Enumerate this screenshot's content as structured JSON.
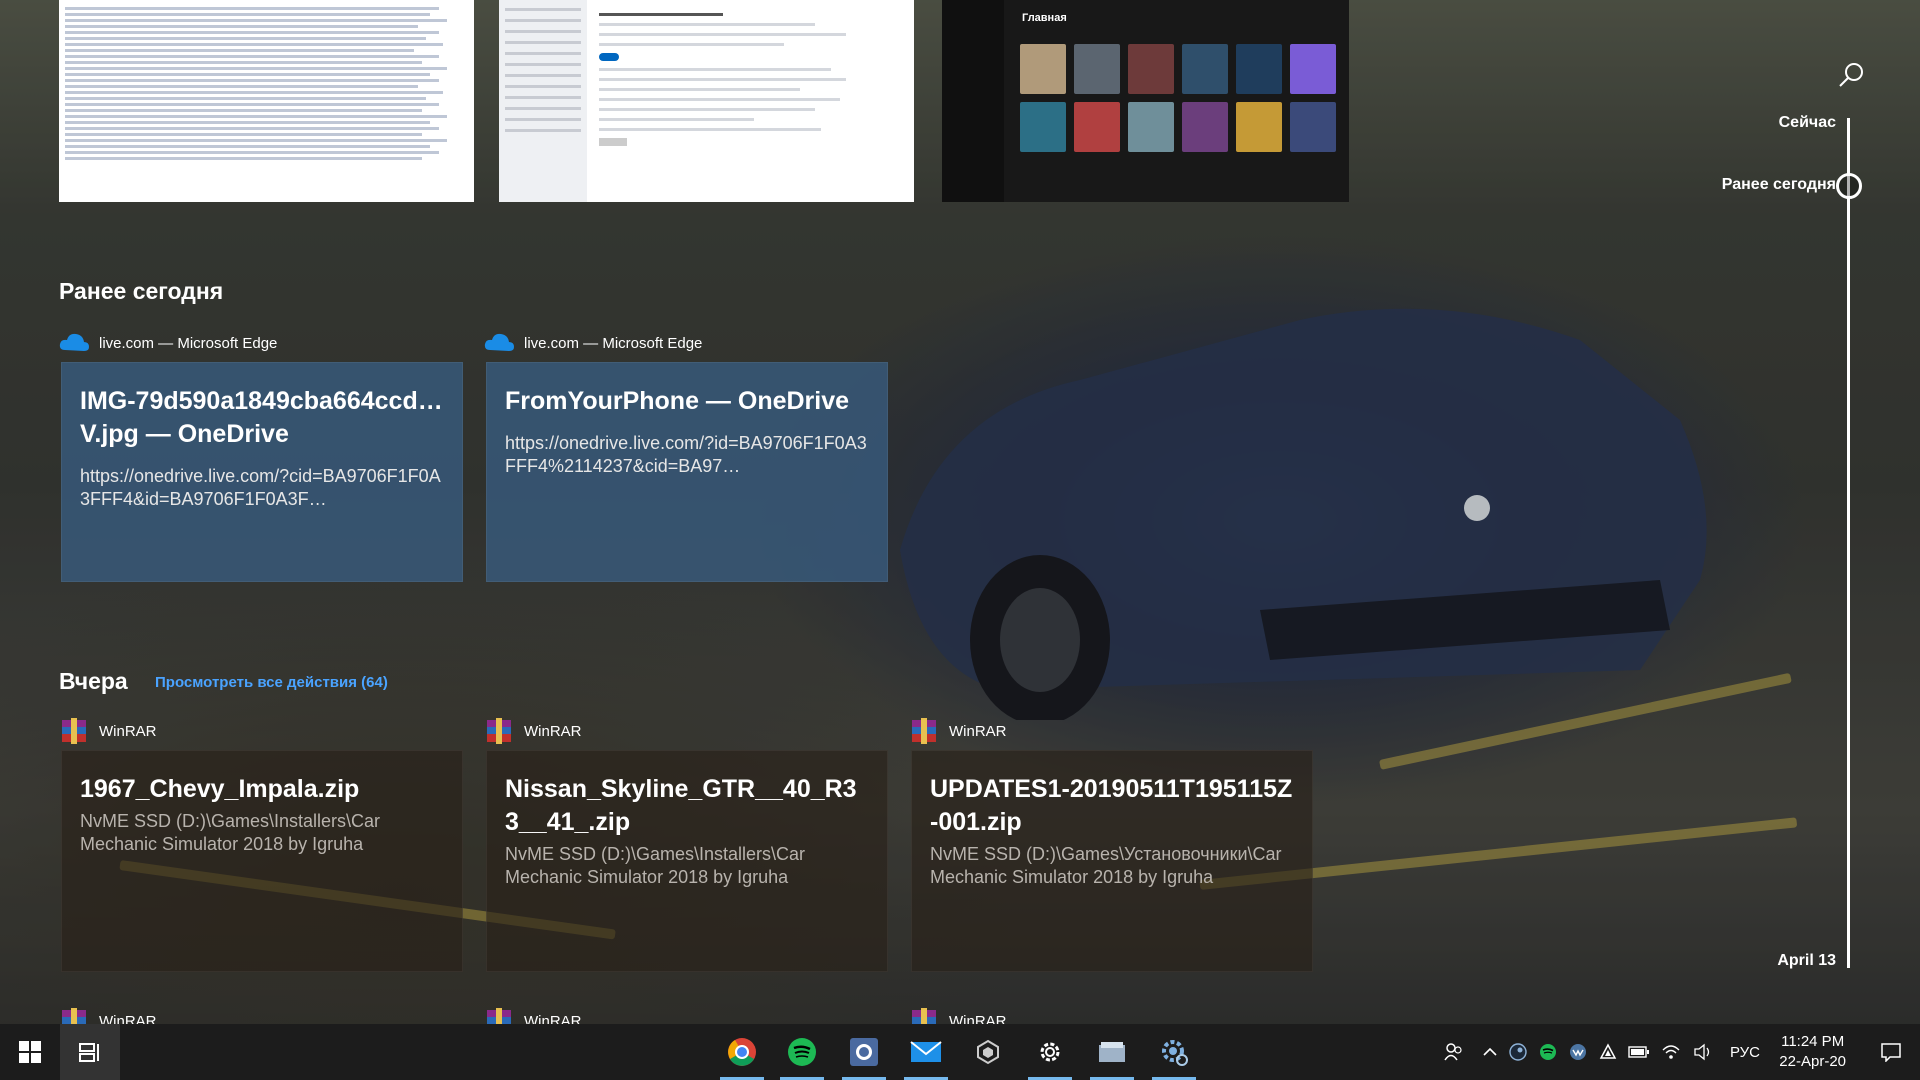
{
  "timeline": {
    "now_label": "Сейчас",
    "earlier_today_label": "Ранее сегодня",
    "date_label": "April 13"
  },
  "sections": {
    "earlier_today": {
      "title": "Ранее сегодня"
    },
    "yesterday": {
      "title": "Вчера",
      "view_all": "Просмотреть все действия (64)"
    }
  },
  "thumbnails": {
    "spotify_title": "Главная"
  },
  "edge_cards": [
    {
      "app": "live.com — Microsoft Edge",
      "title": "IMG-79d590a1849cba664ccd…V.jpg — OneDrive",
      "url": "https://onedrive.live.com/?cid=BA9706F1F0A3FFF4&id=BA9706F1F0A3F…"
    },
    {
      "app": "live.com — Microsoft Edge",
      "title": "FromYourPhone — OneDrive",
      "url": "https://onedrive.live.com/?id=BA9706F1F0A3FFF4%2114237&cid=BA97…"
    }
  ],
  "rar_cards": [
    {
      "app": "WinRAR",
      "title": "1967_Chevy_Impala.zip",
      "path": "NvME SSD (D:)\\Games\\Installers\\Car Mechanic Simulator 2018 by Igruha"
    },
    {
      "app": "WinRAR",
      "title": "Nissan_Skyline_GTR__40_R33__41_.zip",
      "path": "NvME SSD (D:)\\Games\\Installers\\Car Mechanic Simulator 2018 by Igruha"
    },
    {
      "app": "WinRAR",
      "title": "UPDATES1-20190511T195115Z-001.zip",
      "path": "NvME SSD (D:)\\Games\\Установочники\\Car Mechanic Simulator 2018 by Igruha"
    }
  ],
  "more_rows": [
    "WinRAR",
    "WinRAR",
    "WinRAR"
  ],
  "taskbar": {
    "apps": [
      "chrome-icon",
      "spotify-icon",
      "signal-icon",
      "mail-icon",
      "unity-icon",
      "settings-icon",
      "file-explorer-icon",
      "settings-gear-icon"
    ],
    "language": "РУС",
    "time": "11:24 PM",
    "date": "22-Apr-20"
  },
  "colors": {
    "accent": "#4aa3ff",
    "edge_card": "#385a7d",
    "taskbar": "#1c1c1c",
    "spotify_green": "#1db954"
  }
}
